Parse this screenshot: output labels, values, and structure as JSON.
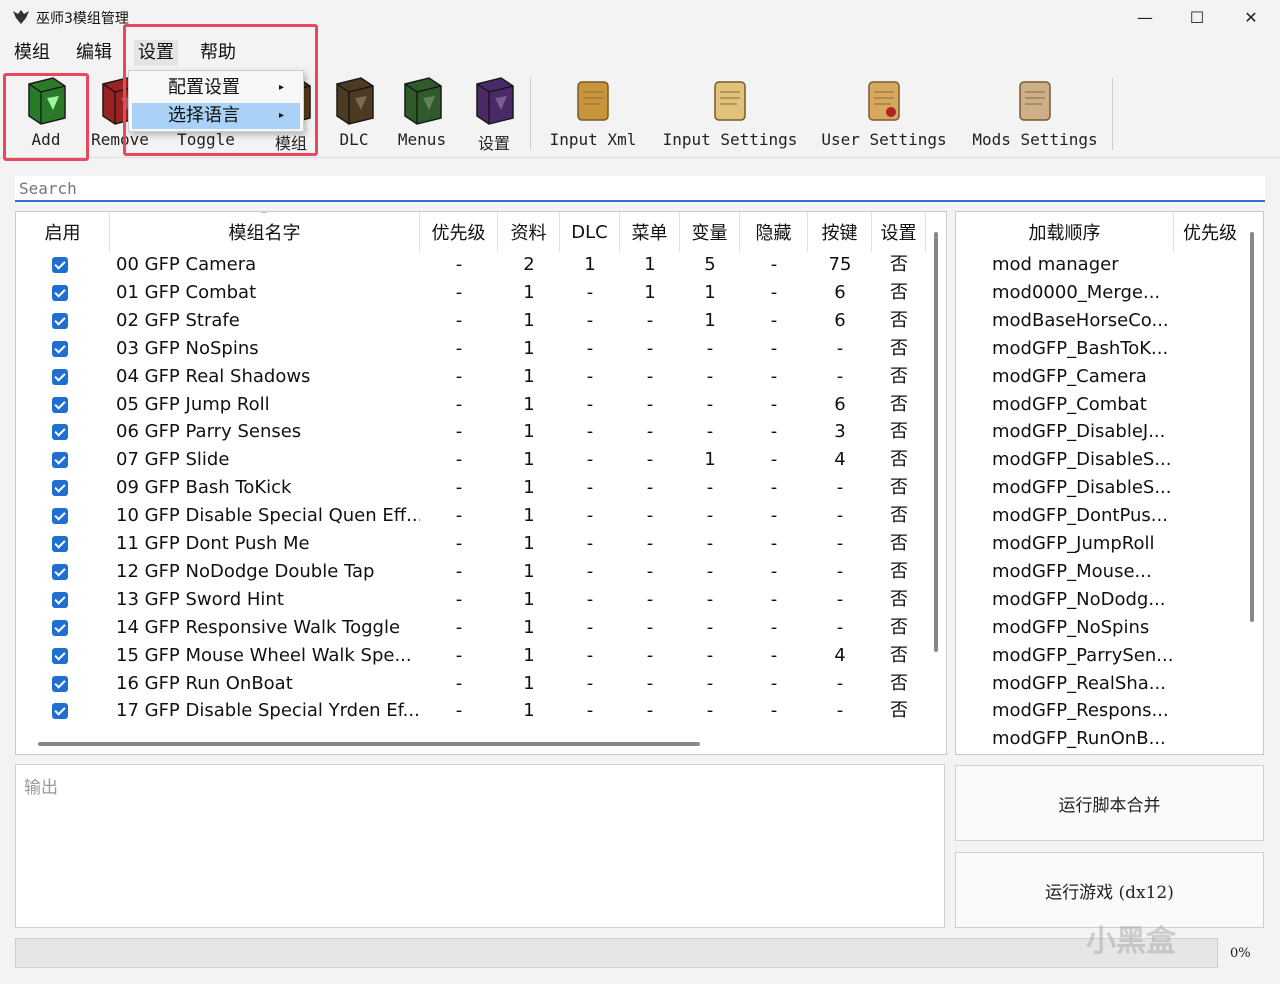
{
  "window": {
    "title": "巫师3模组管理",
    "minimize": "—",
    "maximize": "☐",
    "close": "✕"
  },
  "menubar": [
    "模组",
    "编辑",
    "设置",
    "帮助"
  ],
  "settings_menu": {
    "items": [
      {
        "label": "配置设置",
        "arrow": "▸"
      },
      {
        "label": "选择语言",
        "arrow": "▸"
      }
    ]
  },
  "toolbar": [
    {
      "label": "Add",
      "icon": "green-book-icon",
      "color": "#2a7a2a"
    },
    {
      "label": "Remove",
      "icon": "red-book-icon",
      "color": "#9a2222"
    },
    {
      "label": "Toggle",
      "icon": "brown-book-icon",
      "color": "#6b4a22"
    },
    {
      "label": "模组",
      "icon": "brown-book-icon",
      "color": "#5a3a1a"
    },
    {
      "label": "DLC",
      "icon": "brown-book-icon",
      "color": "#4d3a22"
    },
    {
      "label": "Menus",
      "icon": "green-book-icon",
      "color": "#2f5a2a"
    },
    {
      "label": "设置",
      "icon": "purple-book-icon",
      "color": "#4a2a66"
    },
    {
      "label": "Input Xml",
      "icon": "scroll-icon",
      "color": "#c9953a"
    },
    {
      "label": "Input Settings",
      "icon": "paper-icon",
      "color": "#e0c27a"
    },
    {
      "label": "User Settings",
      "icon": "sealed-paper-icon",
      "color": "#d9a860"
    },
    {
      "label": "Mods Settings",
      "icon": "parchment-icon",
      "color": "#cdb089"
    }
  ],
  "search": {
    "placeholder": "Search"
  },
  "mods_table": {
    "columns": [
      "启用",
      "模组名字",
      "优先级",
      "资料",
      "DLC",
      "菜单",
      "变量",
      "隐藏",
      "按键",
      "设置"
    ],
    "rows": [
      [
        "00 GFP Camera",
        "-",
        "2",
        "1",
        "1",
        "5",
        "-",
        "75",
        "否"
      ],
      [
        "01 GFP Combat",
        "-",
        "1",
        "-",
        "1",
        "1",
        "-",
        "6",
        "否"
      ],
      [
        "02 GFP Strafe",
        "-",
        "1",
        "-",
        "-",
        "1",
        "-",
        "6",
        "否"
      ],
      [
        "03 GFP NoSpins",
        "-",
        "1",
        "-",
        "-",
        "-",
        "-",
        "-",
        "否"
      ],
      [
        "04 GFP Real Shadows",
        "-",
        "1",
        "-",
        "-",
        "-",
        "-",
        "-",
        "否"
      ],
      [
        "05 GFP Jump Roll",
        "-",
        "1",
        "-",
        "-",
        "-",
        "-",
        "6",
        "否"
      ],
      [
        "06 GFP Parry Senses",
        "-",
        "1",
        "-",
        "-",
        "-",
        "-",
        "3",
        "否"
      ],
      [
        "07 GFP Slide",
        "-",
        "1",
        "-",
        "-",
        "1",
        "-",
        "4",
        "否"
      ],
      [
        "09 GFP Bash ToKick",
        "-",
        "1",
        "-",
        "-",
        "-",
        "-",
        "-",
        "否"
      ],
      [
        "10 GFP Disable Special Quen Eff...",
        "-",
        "1",
        "-",
        "-",
        "-",
        "-",
        "-",
        "否"
      ],
      [
        "11 GFP Dont Push Me",
        "-",
        "1",
        "-",
        "-",
        "-",
        "-",
        "-",
        "否"
      ],
      [
        "12 GFP NoDodge Double Tap",
        "-",
        "1",
        "-",
        "-",
        "-",
        "-",
        "-",
        "否"
      ],
      [
        "13 GFP Sword Hint",
        "-",
        "1",
        "-",
        "-",
        "-",
        "-",
        "-",
        "否"
      ],
      [
        "14 GFP Responsive Walk Toggle",
        "-",
        "1",
        "-",
        "-",
        "-",
        "-",
        "-",
        "否"
      ],
      [
        "15 GFP Mouse Wheel Walk Spe...",
        "-",
        "1",
        "-",
        "-",
        "-",
        "-",
        "4",
        "否"
      ],
      [
        "16 GFP Run OnBoat",
        "-",
        "1",
        "-",
        "-",
        "-",
        "-",
        "-",
        "否"
      ],
      [
        "17 GFP Disable Special Yrden Ef...",
        "-",
        "1",
        "-",
        "-",
        "-",
        "-",
        "-",
        "否"
      ]
    ]
  },
  "load_order_table": {
    "columns": [
      "加载顺序",
      "优先级"
    ],
    "rows": [
      "mod manager",
      "mod0000_Merge...",
      "modBaseHorseCo...",
      "modGFP_BashToK...",
      "modGFP_Camera",
      "modGFP_Combat",
      "modGFP_DisableJ...",
      "modGFP_DisableS...",
      "modGFP_DisableS...",
      "modGFP_DontPus...",
      "modGFP_JumpRoll",
      "modGFP_Mouse...",
      "modGFP_NoDodg...",
      "modGFP_NoSpins",
      "modGFP_ParrySen...",
      "modGFP_RealSha...",
      "modGFP_Respons...",
      "modGFP_RunOnB..."
    ]
  },
  "output": {
    "placeholder": "输出"
  },
  "buttons": {
    "merge": "运行脚本合并",
    "run_game": "运行游戏 (dx12)"
  },
  "progress": {
    "value": 0,
    "label": "0%"
  },
  "watermark": "小黑盒",
  "colors": {
    "highlight": "#e8475d",
    "accent": "#1f6fd0",
    "menu_selected": "#a9d2f6"
  }
}
